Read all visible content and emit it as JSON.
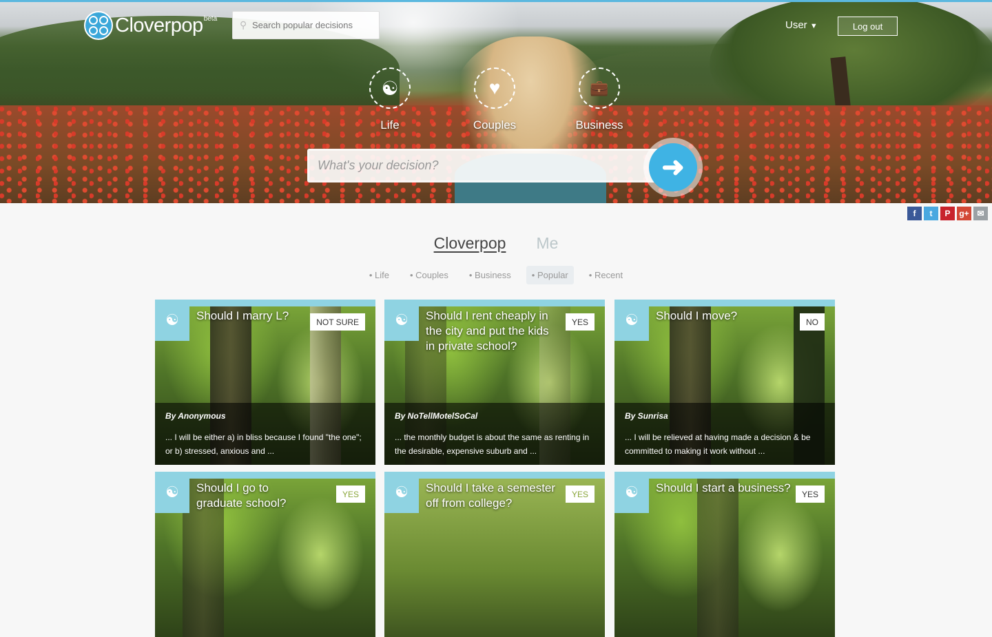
{
  "brand": {
    "name": "Cloverpop",
    "tag": "beta"
  },
  "header": {
    "search_placeholder": "Search popular decisions",
    "user_label": "User",
    "user_chevron": "chevron-down-icon",
    "logout_label": "Log out"
  },
  "categories": [
    {
      "label": "Life",
      "icon": "yin-yang-icon"
    },
    {
      "label": "Couples",
      "icon": "heart-icon"
    },
    {
      "label": "Business",
      "icon": "briefcase-icon"
    }
  ],
  "decision": {
    "placeholder": "What's your decision?",
    "submit_icon": "arrow-right-icon"
  },
  "share": [
    {
      "icon": "facebook-icon",
      "glyph": "f",
      "color": "#3b5998"
    },
    {
      "icon": "twitter-icon",
      "glyph": "t",
      "color": "#4aa8e0"
    },
    {
      "icon": "pinterest-icon",
      "glyph": "P",
      "color": "#c8232c"
    },
    {
      "icon": "google-plus-icon",
      "glyph": "g+",
      "color": "#d34836"
    },
    {
      "icon": "email-icon",
      "glyph": "✉",
      "color": "#9ba1a5"
    }
  ],
  "main_tabs": [
    {
      "label": "Cloverpop",
      "active": true
    },
    {
      "label": "Me",
      "active": false
    }
  ],
  "sub_tabs": [
    {
      "label": "Life",
      "active": false
    },
    {
      "label": "Couples",
      "active": false
    },
    {
      "label": "Business",
      "active": false
    },
    {
      "label": "Popular",
      "active": true
    },
    {
      "label": "Recent",
      "active": false
    }
  ],
  "cards": [
    {
      "title": "Should I marry L?",
      "badge": "NOT SURE",
      "author": "By Anonymous",
      "excerpt": "... I will be either a) in bliss because I found \"the one\"; or b) stressed, anxious and ..."
    },
    {
      "title": "Should I rent cheaply in the city and put the kids in private school?",
      "badge": "YES",
      "author": "By NoTellMotelSoCal",
      "excerpt": "... the monthly budget is about the same as renting in the desirable, expensive suburb and ..."
    },
    {
      "title": "Should I move?",
      "badge": "NO",
      "author": "By Sunrisa",
      "excerpt": "... I will be relieved at having made a decision & be committed to making it work without ..."
    },
    {
      "title": "Should I go to graduate school?",
      "badge": "YES",
      "author": "",
      "excerpt": ""
    },
    {
      "title": "Should I take a semester off from college?",
      "badge": "YES",
      "author": "",
      "excerpt": ""
    },
    {
      "title": "Should I start a business?",
      "badge": "YES",
      "author": "",
      "excerpt": ""
    }
  ],
  "colors": {
    "accent": "#3fb3e4",
    "card_tag": "#8fd3e2"
  }
}
